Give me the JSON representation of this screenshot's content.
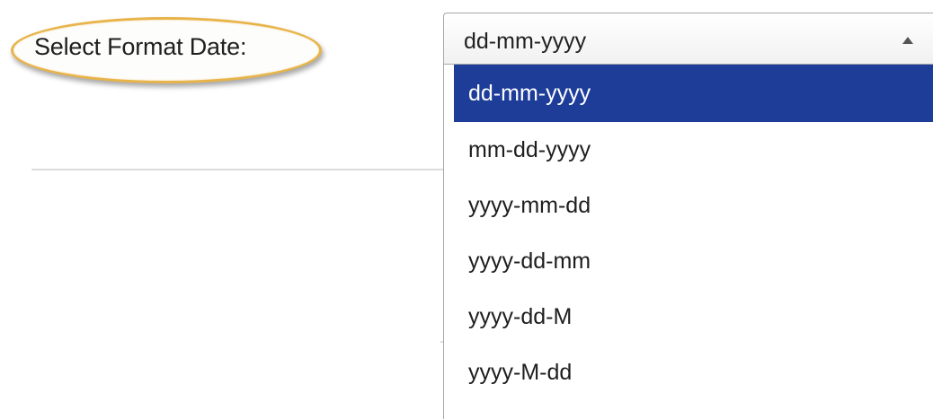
{
  "form": {
    "label": "Select Format Date:"
  },
  "select": {
    "current_value": "dd-mm-yyyy",
    "selected_color": "#1d3d99",
    "highlight_color": "#e8b44a",
    "arrow_icon": "triangle-up-icon",
    "options": [
      {
        "label": "dd-mm-yyyy",
        "selected": true
      },
      {
        "label": "mm-dd-yyyy",
        "selected": false
      },
      {
        "label": "yyyy-mm-dd",
        "selected": false
      },
      {
        "label": "yyyy-dd-mm",
        "selected": false
      },
      {
        "label": "yyyy-dd-M",
        "selected": false
      },
      {
        "label": "yyyy-M-dd",
        "selected": false
      }
    ]
  }
}
